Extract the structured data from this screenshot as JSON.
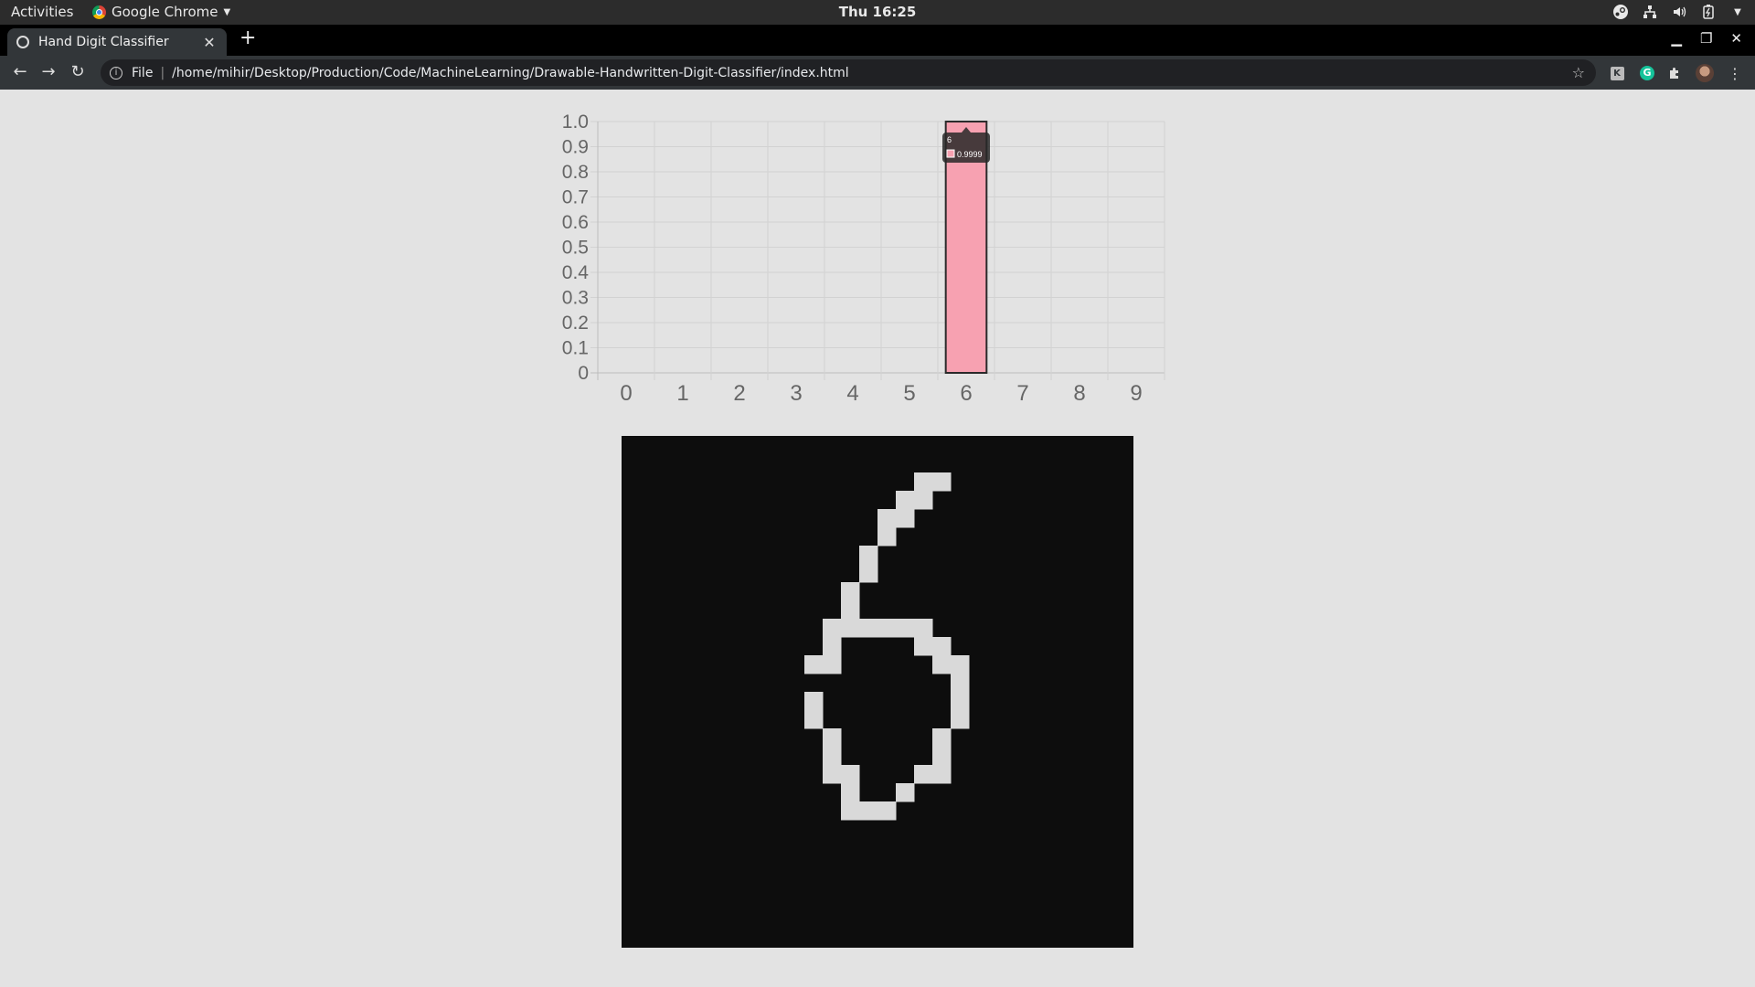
{
  "os": {
    "activities": "Activities",
    "app_name": "Google Chrome",
    "clock": "Thu 16:25"
  },
  "browser": {
    "tab_title": "Hand Digit Classifier",
    "scheme": "File",
    "url": "/home/mihir/Desktop/Production/Code/MachineLearning/Drawable-Handwritten-Digit-Classifier/index.html"
  },
  "chart_data": {
    "type": "bar",
    "categories": [
      "0",
      "1",
      "2",
      "3",
      "4",
      "5",
      "6",
      "7",
      "8",
      "9"
    ],
    "values": [
      0,
      0,
      0,
      0,
      0,
      0,
      0.9999,
      0,
      0,
      0
    ],
    "ylim": [
      0,
      1.0
    ],
    "yticks": [
      "0",
      "0.1",
      "0.2",
      "0.3",
      "0.4",
      "0.5",
      "0.6",
      "0.7",
      "0.8",
      "0.9",
      "1.0"
    ],
    "grid": true,
    "bar_color": "#f7a1b1",
    "bar_border": "#2a2a2a",
    "tooltip": {
      "title": "6",
      "value": "0.9999"
    }
  },
  "drawing": {
    "background": "#0d0d0d",
    "stroke_color": "#d9d9d9",
    "grid_size": 28,
    "pixels": [
      [
        16,
        2
      ],
      [
        17,
        2
      ],
      [
        15,
        3
      ],
      [
        16,
        3
      ],
      [
        14,
        4
      ],
      [
        15,
        4
      ],
      [
        14,
        5
      ],
      [
        13,
        6
      ],
      [
        13,
        7
      ],
      [
        12,
        8
      ],
      [
        12,
        9
      ],
      [
        11,
        10
      ],
      [
        12,
        10
      ],
      [
        13,
        10
      ],
      [
        14,
        10
      ],
      [
        15,
        10
      ],
      [
        16,
        10
      ],
      [
        11,
        11
      ],
      [
        16,
        11
      ],
      [
        17,
        11
      ],
      [
        10,
        12
      ],
      [
        11,
        12
      ],
      [
        17,
        12
      ],
      [
        18,
        12
      ],
      [
        18,
        13
      ],
      [
        10,
        14
      ],
      [
        18,
        14
      ],
      [
        10,
        15
      ],
      [
        18,
        15
      ],
      [
        11,
        16
      ],
      [
        17,
        16
      ],
      [
        11,
        17
      ],
      [
        17,
        17
      ],
      [
        11,
        18
      ],
      [
        12,
        18
      ],
      [
        16,
        18
      ],
      [
        17,
        18
      ],
      [
        12,
        19
      ],
      [
        15,
        19
      ],
      [
        12,
        20
      ],
      [
        13,
        20
      ],
      [
        14,
        20
      ]
    ]
  }
}
